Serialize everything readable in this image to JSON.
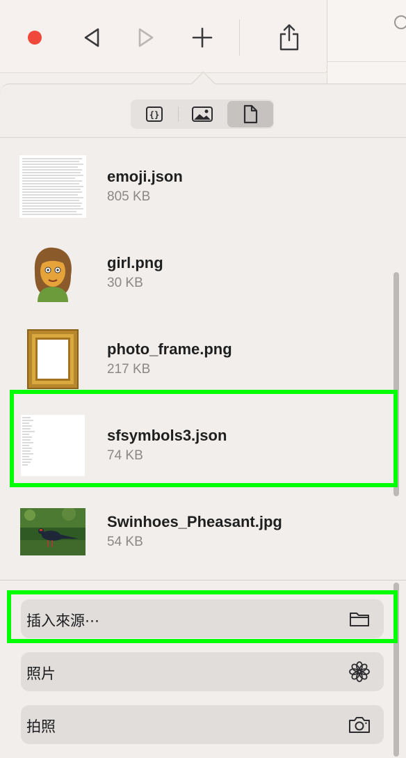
{
  "toolbar": {
    "record": "record-icon",
    "back": "back-triangle-icon",
    "forward": "forward-triangle-icon",
    "add": "plus-icon",
    "share": "share-icon"
  },
  "segments": [
    {
      "icon": "json-braces-icon",
      "active": false
    },
    {
      "icon": "image-icon",
      "active": false
    },
    {
      "icon": "document-icon",
      "active": true
    }
  ],
  "files": [
    {
      "name": "emoji.json",
      "size": "805 KB",
      "thumb": "text-doc"
    },
    {
      "name": "girl.png",
      "size": "30 KB",
      "thumb": "girl"
    },
    {
      "name": "photo_frame.png",
      "size": "217 KB",
      "thumb": "frame"
    },
    {
      "name": "sfsymbols3.json",
      "size": "74 KB",
      "thumb": "text-doc-sparse"
    },
    {
      "name": "Swinhoes_Pheasant.jpg",
      "size": "54 KB",
      "thumb": "pheasant"
    }
  ],
  "actions": [
    {
      "label": "插入來源⋯",
      "icon": "folder-icon"
    },
    {
      "label": "照片",
      "icon": "flower-icon"
    },
    {
      "label": "拍照",
      "icon": "camera-icon"
    }
  ],
  "colors": {
    "highlight": "#00ff00",
    "record": "#f0483a"
  }
}
